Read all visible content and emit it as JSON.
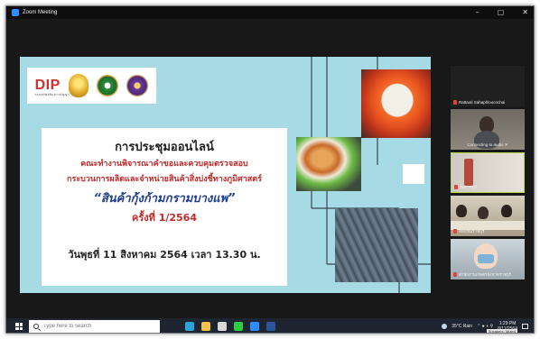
{
  "window": {
    "title": "Zoom Meeting",
    "minimize": "–",
    "maximize": "▢",
    "close": "✕"
  },
  "slide": {
    "line1": "การประชุมออนไลน์",
    "line2": "คณะทำงานพิจารณาคำขอและควบคุมตรวจสอบ",
    "line3": "กระบวนการผลิตและจำหน่ายสินค้าสิ่งบ่งชี้ทางภูมิศาสตร์",
    "line4": "“สินค้ากุ้งก้ามกรามบางแพ”",
    "line5": "ครั้งที่ 1/2564",
    "line6": "วันพุธที่  11  สิงหาคม  2564 เวลา  13.30 น.",
    "logo_text": "DIP",
    "logo_subtext": "กรมทรัพย์สินทางปัญญา"
  },
  "participants": [
    {
      "name": "Rattaoti Sahaphloocnchai",
      "muted": true
    },
    {
      "name": "Connecting to audio ✕",
      "muted": false
    },
    {
      "name": "สดราชบุรี",
      "muted": true
    },
    {
      "name": "สหกรณ์ราชบุรี",
      "muted": true
    },
    {
      "name": "สำนักงานเกษตรจังหวัดราชบุรี",
      "muted": true
    }
  ],
  "taskbar": {
    "search_placeholder": "Type here to search",
    "weather": "35°C  Rain",
    "time": "1:29 PM",
    "date": "8/11/2564",
    "speaker_badge": "Speakers: Muted",
    "icons": [
      "edge-icon",
      "file-explorer-icon",
      "store-icon",
      "line-app-icon",
      "zoom-icon",
      "word-icon"
    ]
  },
  "colors": {
    "slide_bg": "#a6dbe6",
    "title_red": "#c02a2a",
    "title_blue": "#1f3d8f",
    "active_speaker_border": "#b8d84a",
    "muted_mic": "#e0443e"
  }
}
